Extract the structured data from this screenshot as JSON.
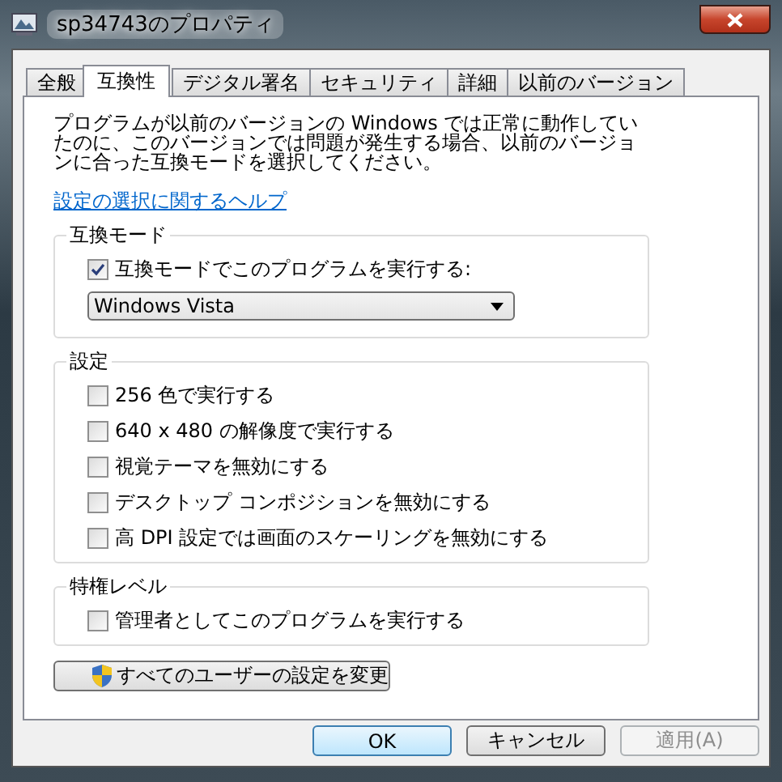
{
  "window": {
    "title": "sp34743のプロパティ"
  },
  "tabs": [
    {
      "label": "全般",
      "selected": false
    },
    {
      "label": "互換性",
      "selected": true
    },
    {
      "label": "デジタル署名",
      "selected": false
    },
    {
      "label": "セキュリティ",
      "selected": false
    },
    {
      "label": "詳細",
      "selected": false
    },
    {
      "label": "以前のバージョン",
      "selected": false
    }
  ],
  "description": "プログラムが以前のバージョンの Windows では正常に動作していたのに、このバージョンでは問題が発生する場合、以前のバージョンに合った互換モードを選択してください。",
  "help_link": "設定の選択に関するヘルプ",
  "compat_mode": {
    "title": "互換モード",
    "checkbox": {
      "label": "互換モードでこのプログラムを実行する:",
      "checked": true
    },
    "dropdown": {
      "value": "Windows Vista"
    }
  },
  "settings": {
    "title": "設定",
    "options": [
      {
        "label": "256 色で実行する",
        "checked": false
      },
      {
        "label": "640 x 480 の解像度で実行する",
        "checked": false
      },
      {
        "label": "視覚テーマを無効にする",
        "checked": false
      },
      {
        "label": "デスクトップ コンポジションを無効にする",
        "checked": false
      },
      {
        "label": "高 DPI 設定では画面のスケーリングを無効にする",
        "checked": false
      }
    ]
  },
  "privilege": {
    "title": "特権レベル",
    "options": [
      {
        "label": "管理者としてこのプログラムを実行する",
        "checked": false
      }
    ]
  },
  "change_all_button": "すべてのユーザーの設定を変更",
  "buttons": [
    {
      "label": "OK",
      "default": true,
      "disabled": false
    },
    {
      "label": "キャンセル",
      "default": false,
      "disabled": false
    },
    {
      "label": "適用(A)",
      "default": false,
      "disabled": true
    }
  ]
}
